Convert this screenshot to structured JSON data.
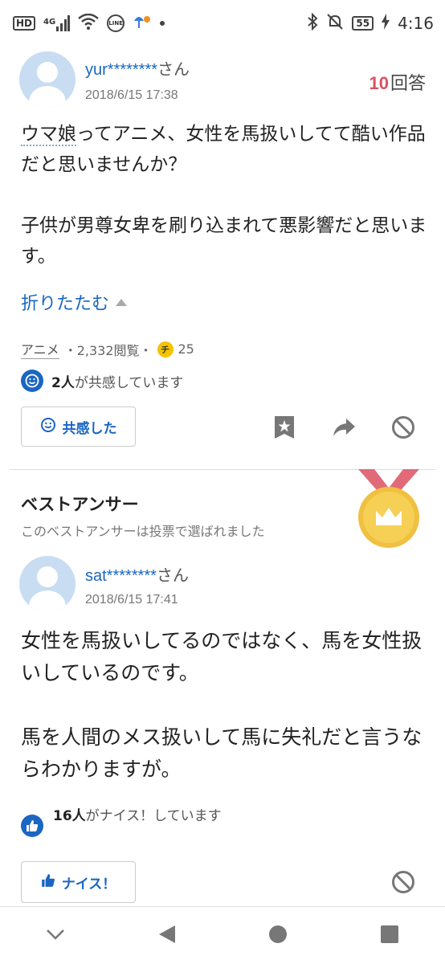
{
  "status_bar": {
    "hd": "HD",
    "network": "4G",
    "line_app": "LINE",
    "battery": "55",
    "time": "4:16"
  },
  "question": {
    "username": "yur********",
    "honorific": "さん",
    "date": "2018/6/15 17:38",
    "answer_count": "10",
    "answer_count_label": "回答",
    "text_highlight": "ウマ娘",
    "text_rest": "ってアニメ、女性を馬扱いしてて酷い作品だと思いませんか？\n\n子供が男尊女卑を刷り込まれて悪影響だと思います。",
    "fold_label": "折りたたむ",
    "category": "アニメ",
    "views": "・2,332閲覧・",
    "coin_icon": "チ",
    "coins": "25",
    "empathy_count": "2人",
    "empathy_text": "が共感しています",
    "empathy_button": "共感した"
  },
  "best_answer": {
    "title": "ベストアンサー",
    "subtitle": "このベストアンサーは投票で選ばれました",
    "username": "sat********",
    "honorific": "さん",
    "date": "2018/6/15 17:41",
    "text": "女性を馬扱いしてるのではなく、馬を女性扱いしているのです。\n\n馬を人間のメス扱いして馬に失礼だと言うならわかりますが。",
    "nice_count": "16人",
    "nice_text": "がナイス！しています",
    "nice_button": "ナイス！"
  },
  "icons": [
    "bookmark-star-icon",
    "share-icon",
    "block-icon",
    "thumbs-up-icon",
    "smile-icon",
    "crown-icon"
  ],
  "colors": {
    "accent": "#1a66c2",
    "answer_count": "#e05060",
    "medal_gold": "#f2c94c",
    "ribbon": "#e06070"
  }
}
